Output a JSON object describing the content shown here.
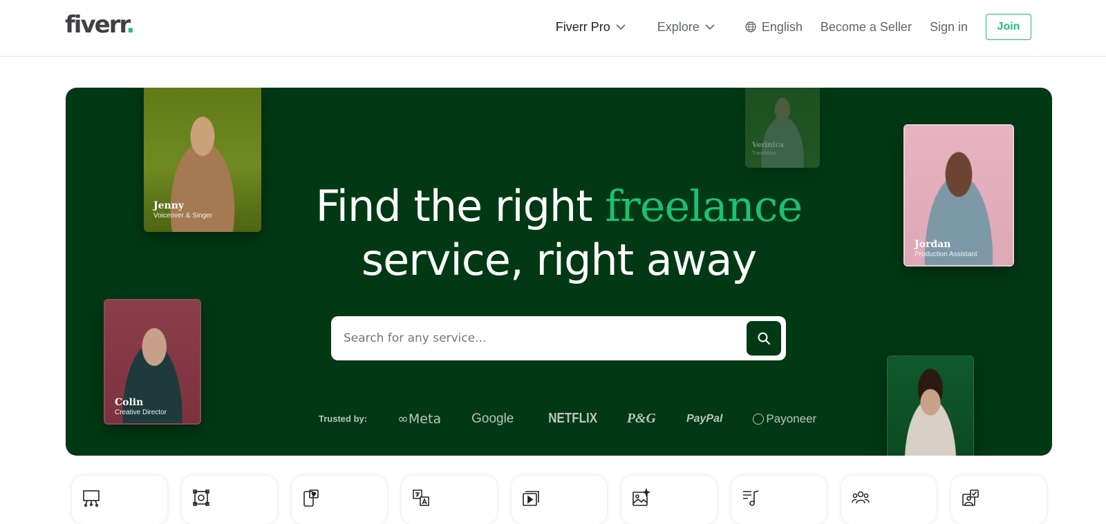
{
  "header": {
    "logo_text": "fiverr",
    "logo_dot": ".",
    "nav": {
      "fiverr_pro": "Fiverr Pro",
      "explore": "Explore",
      "language": "English",
      "become_seller": "Become a Seller",
      "sign_in": "Sign in",
      "join": "Join"
    }
  },
  "hero": {
    "headline_part1": "Find the right ",
    "headline_accent": "freelance",
    "headline_part2": "service, right away",
    "search": {
      "placeholder": "Search for any service..."
    },
    "trusted_label": "Trusted by:",
    "brands": [
      "Meta",
      "Google",
      "NETFLIX",
      "P&G",
      "PayPal",
      "Payoneer"
    ],
    "people": [
      {
        "name": "Jenny",
        "role": "Voiceover & Singer"
      },
      {
        "name": "Verinica",
        "role": "Translation"
      },
      {
        "name": "Jordan",
        "role": "Production Assistant"
      },
      {
        "name": "Colin",
        "role": "Creative Director"
      },
      {
        "name": "",
        "role": ""
      }
    ]
  },
  "categories": {
    "icons": [
      "presentation-icon",
      "logo-design-icon",
      "mobile-app-icon",
      "translation-icon",
      "video-icon",
      "ai-image-icon",
      "music-icon",
      "team-icon",
      "portrait-icon"
    ]
  },
  "colors": {
    "brand_green": "#1dbf73",
    "hero_background": "#013914",
    "text_dark": "#404145"
  }
}
